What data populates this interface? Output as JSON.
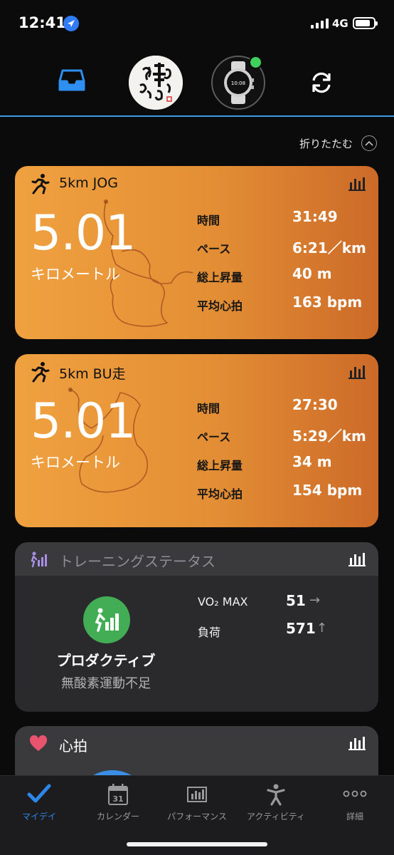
{
  "status_bar": {
    "time": "12:41",
    "network": "4G"
  },
  "header": {
    "avatar_text": "あなたが幸せでありますように",
    "watch_face_time": "10:08"
  },
  "collapse_label": "折りたたむ",
  "activities": [
    {
      "title": "5km JOG",
      "distance": "5.01",
      "unit": "キロメートル",
      "stats": [
        {
          "label": "時間",
          "value": "31:49"
        },
        {
          "label": "ペース",
          "value": "6:21／km"
        },
        {
          "label": "総上昇量",
          "value": "40 m"
        },
        {
          "label": "平均心拍",
          "value": "163 bpm"
        }
      ]
    },
    {
      "title": "5km BU走",
      "distance": "5.01",
      "unit": "キロメートル",
      "stats": [
        {
          "label": "時間",
          "value": "27:30"
        },
        {
          "label": "ペース",
          "value": "5:29／km"
        },
        {
          "label": "総上昇量",
          "value": "34 m"
        },
        {
          "label": "平均心拍",
          "value": "154 bpm"
        }
      ]
    }
  ],
  "training_status": {
    "title": "トレーニングステータス",
    "state": "プロダクティブ",
    "substate": "無酸素運動不足",
    "vo2_label": "VO₂ MAX",
    "vo2_value": "51",
    "vo2_trend": "→",
    "load_label": "負荷",
    "load_value": "571",
    "load_trend": "↑"
  },
  "heart_rate": {
    "title": "心拍"
  },
  "tabs": [
    {
      "label": "マイデイ",
      "icon": "checkmark-icon",
      "active": true
    },
    {
      "label": "カレンダー",
      "icon": "calendar-icon",
      "day": "31"
    },
    {
      "label": "パフォーマンス",
      "icon": "performance-chart-icon"
    },
    {
      "label": "アクティビティ",
      "icon": "activity-person-icon"
    },
    {
      "label": "詳細",
      "icon": "more-icon"
    }
  ],
  "colors": {
    "accent": "#2e86e8",
    "card_orange": "#e38e35",
    "status_green": "#42ad55",
    "heart_pink": "#e8536e"
  }
}
